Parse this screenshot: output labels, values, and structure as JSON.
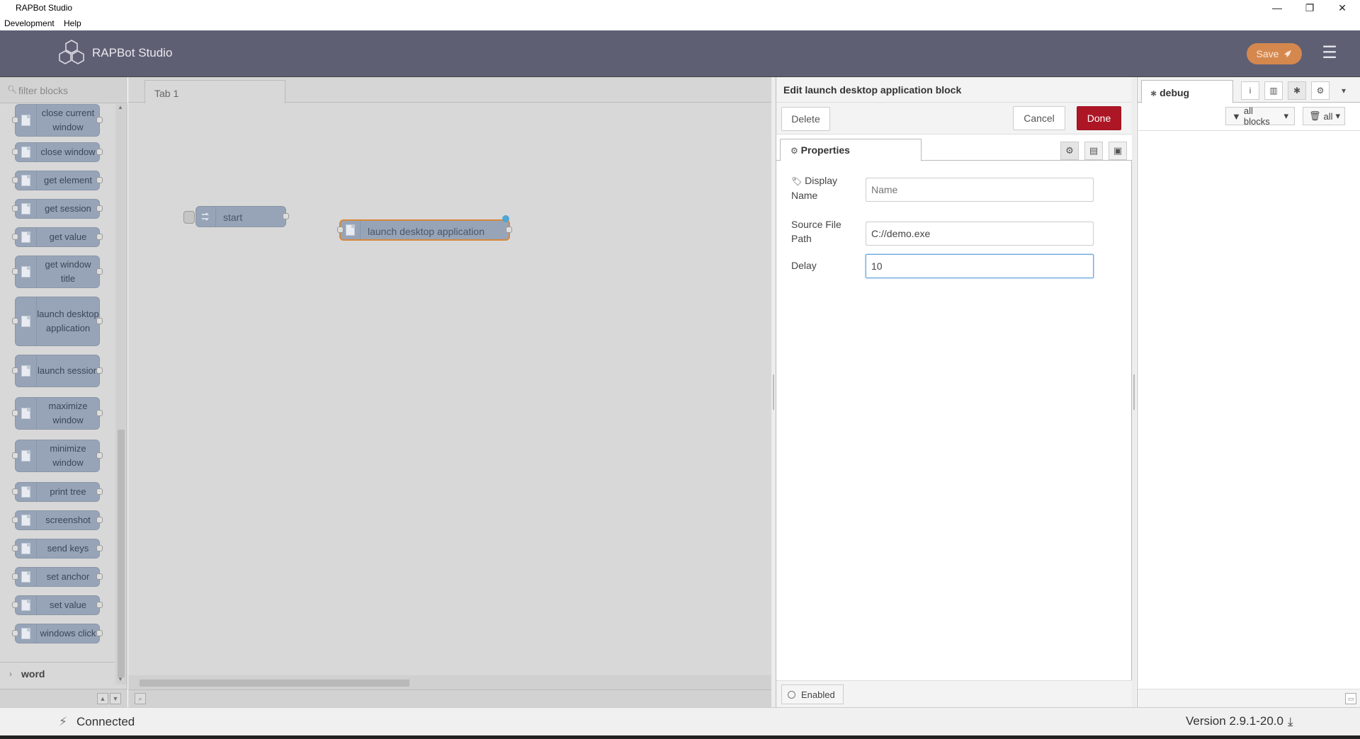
{
  "window": {
    "title": "RAPBot Studio",
    "minimize": "—",
    "restore": "❐",
    "close": "✕"
  },
  "menubar": {
    "items": [
      "Development",
      "Help"
    ]
  },
  "header": {
    "brand": "RAPBot Studio",
    "save_label": "Save",
    "menu_glyph": "☰"
  },
  "palette": {
    "search_placeholder": "filter blocks",
    "blocks": [
      {
        "label": "close current window"
      },
      {
        "label": "close window"
      },
      {
        "label": "get element"
      },
      {
        "label": "get session"
      },
      {
        "label": "get value"
      },
      {
        "label": "get window title"
      },
      {
        "label": "launch desktop application"
      },
      {
        "label": "launch session"
      },
      {
        "label": "maximize window"
      },
      {
        "label": "minimize window"
      },
      {
        "label": "print tree"
      },
      {
        "label": "screenshot"
      },
      {
        "label": "send keys"
      },
      {
        "label": "set anchor"
      },
      {
        "label": "set value"
      },
      {
        "label": "windows click"
      }
    ],
    "category": "word",
    "category_chevron": "›"
  },
  "workspace": {
    "tab_label": "Tab 1",
    "nodes": {
      "start": "start",
      "launch": "launch desktop application"
    }
  },
  "tray": {
    "title": "Edit launch desktop application block",
    "delete_label": "Delete",
    "cancel_label": "Cancel",
    "done_label": "Done",
    "tab_label": "Properties",
    "fields": {
      "display_name": {
        "label": "Display Name",
        "placeholder": "Name",
        "value": ""
      },
      "source_path": {
        "label": "Source File Path",
        "value": "C://demo.exe"
      },
      "delay": {
        "label": "Delay",
        "value": "10"
      }
    },
    "enabled_label": "Enabled"
  },
  "sidebar": {
    "tab_label": "debug",
    "filter_blocks": "all blocks",
    "clear_label": "all",
    "icons": [
      "info-icon",
      "book-icon",
      "bug-icon",
      "gear-icon",
      "caret-down-icon"
    ]
  },
  "status": {
    "connection": "Connected",
    "version": "Version 2.9.1-20.0"
  },
  "colors": {
    "header": "#5f5f74",
    "save": "#d5884e",
    "done": "#ad1625",
    "node": "#97a4b8",
    "selected_border": "#d6883a"
  }
}
